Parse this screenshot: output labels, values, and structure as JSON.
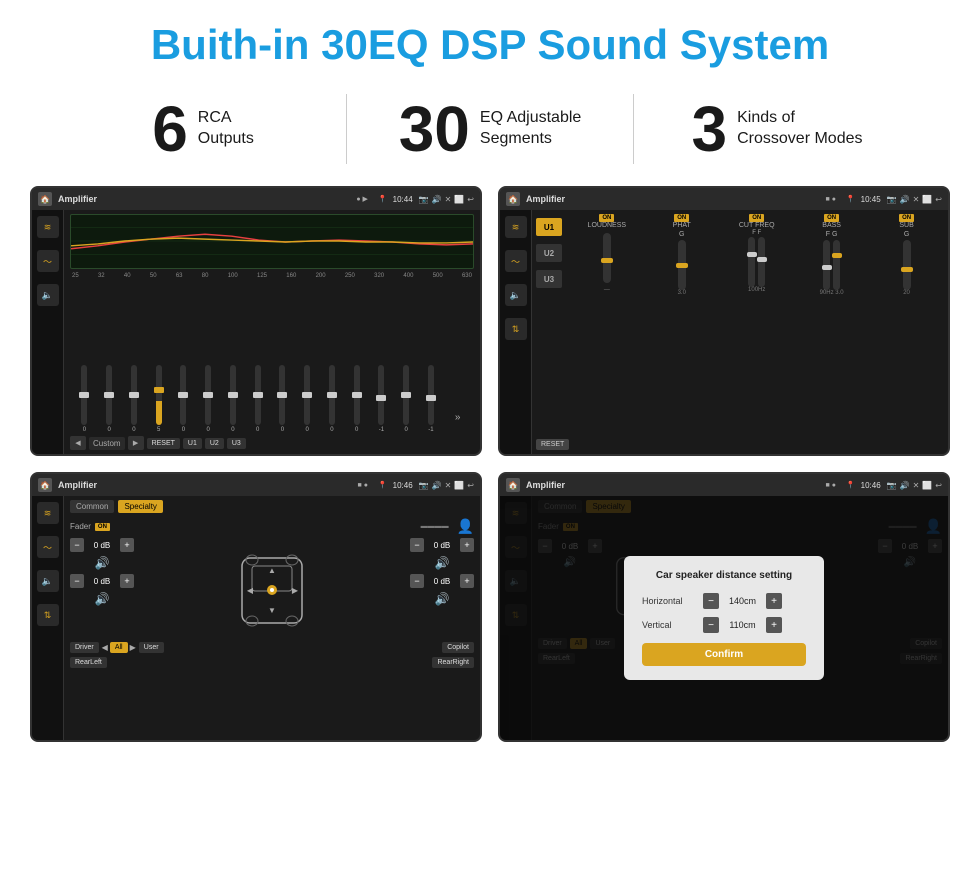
{
  "page": {
    "title": "Buith-in 30EQ DSP Sound System",
    "stats": [
      {
        "number": "6",
        "label_line1": "RCA",
        "label_line2": "Outputs"
      },
      {
        "number": "30",
        "label_line1": "EQ Adjustable",
        "label_line2": "Segments"
      },
      {
        "number": "3",
        "label_line1": "Kinds of",
        "label_line2": "Crossover Modes"
      }
    ]
  },
  "screens": {
    "eq": {
      "title": "Amplifier",
      "time": "10:44",
      "freq_labels": [
        "25",
        "32",
        "40",
        "50",
        "63",
        "80",
        "100",
        "125",
        "160",
        "200",
        "250",
        "320",
        "400",
        "500",
        "630"
      ],
      "slider_values": [
        "0",
        "0",
        "0",
        "5",
        "0",
        "0",
        "0",
        "0",
        "0",
        "0",
        "0",
        "0",
        "-1",
        "0",
        "-1"
      ],
      "presets": [
        "Custom",
        "RESET",
        "U1",
        "U2",
        "U3"
      ]
    },
    "crossover": {
      "title": "Amplifier",
      "time": "10:45",
      "u_buttons": [
        "U1",
        "U2",
        "U3"
      ],
      "controls": [
        "LOUDNESS",
        "PHAT",
        "CUT FREQ",
        "BASS",
        "SUB"
      ],
      "reset_label": "RESET"
    },
    "fader": {
      "title": "Amplifier",
      "time": "10:46",
      "tabs": [
        "Common",
        "Specialty"
      ],
      "fader_label": "Fader",
      "on_label": "ON",
      "volumes": [
        "0 dB",
        "0 dB",
        "0 dB",
        "0 dB"
      ],
      "buttons": [
        "Driver",
        "All",
        "User",
        "RearLeft",
        "RearRight",
        "Copilot"
      ]
    },
    "distance": {
      "title": "Amplifier",
      "time": "10:46",
      "tabs": [
        "Common",
        "Specialty"
      ],
      "dialog_title": "Car speaker distance setting",
      "horizontal_label": "Horizontal",
      "horizontal_value": "140cm",
      "vertical_label": "Vertical",
      "vertical_value": "110cm",
      "confirm_label": "Confirm",
      "volumes": [
        "0 dB",
        "0 dB"
      ],
      "buttons": [
        "Driver",
        "All",
        "User",
        "RearLeft",
        "RearRight",
        "Copilot"
      ]
    }
  }
}
